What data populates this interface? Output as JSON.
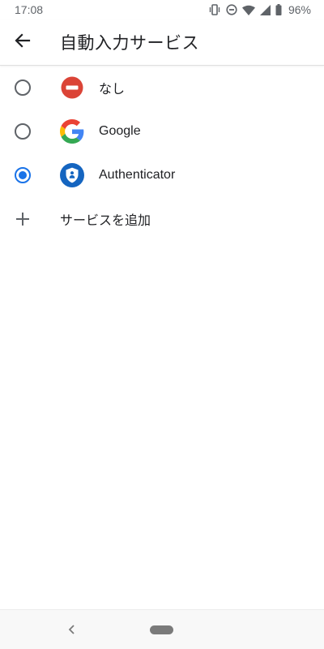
{
  "status_bar": {
    "time": "17:08",
    "battery_percent": "96%",
    "icons": [
      "vibrate-icon",
      "do-not-disturb-icon",
      "wifi-icon",
      "cell-signal-icon",
      "battery-icon"
    ]
  },
  "app_bar": {
    "back_icon": "arrow-back-icon",
    "title": "自動入力サービス"
  },
  "options": [
    {
      "label": "なし",
      "icon": "none-icon",
      "selected": false
    },
    {
      "label": "Google",
      "icon": "google-logo-icon",
      "selected": false
    },
    {
      "label": "Authenticator",
      "icon": "authenticator-icon",
      "selected": true
    }
  ],
  "add_service": {
    "icon": "plus-icon",
    "label": "サービスを追加"
  },
  "nav_bar": {
    "back_icon": "nav-back-icon",
    "home_icon": "home-pill-icon"
  },
  "colors": {
    "accent": "#1a73e8",
    "none_red": "#db4437",
    "authenticator_blue": "#1565c0"
  }
}
